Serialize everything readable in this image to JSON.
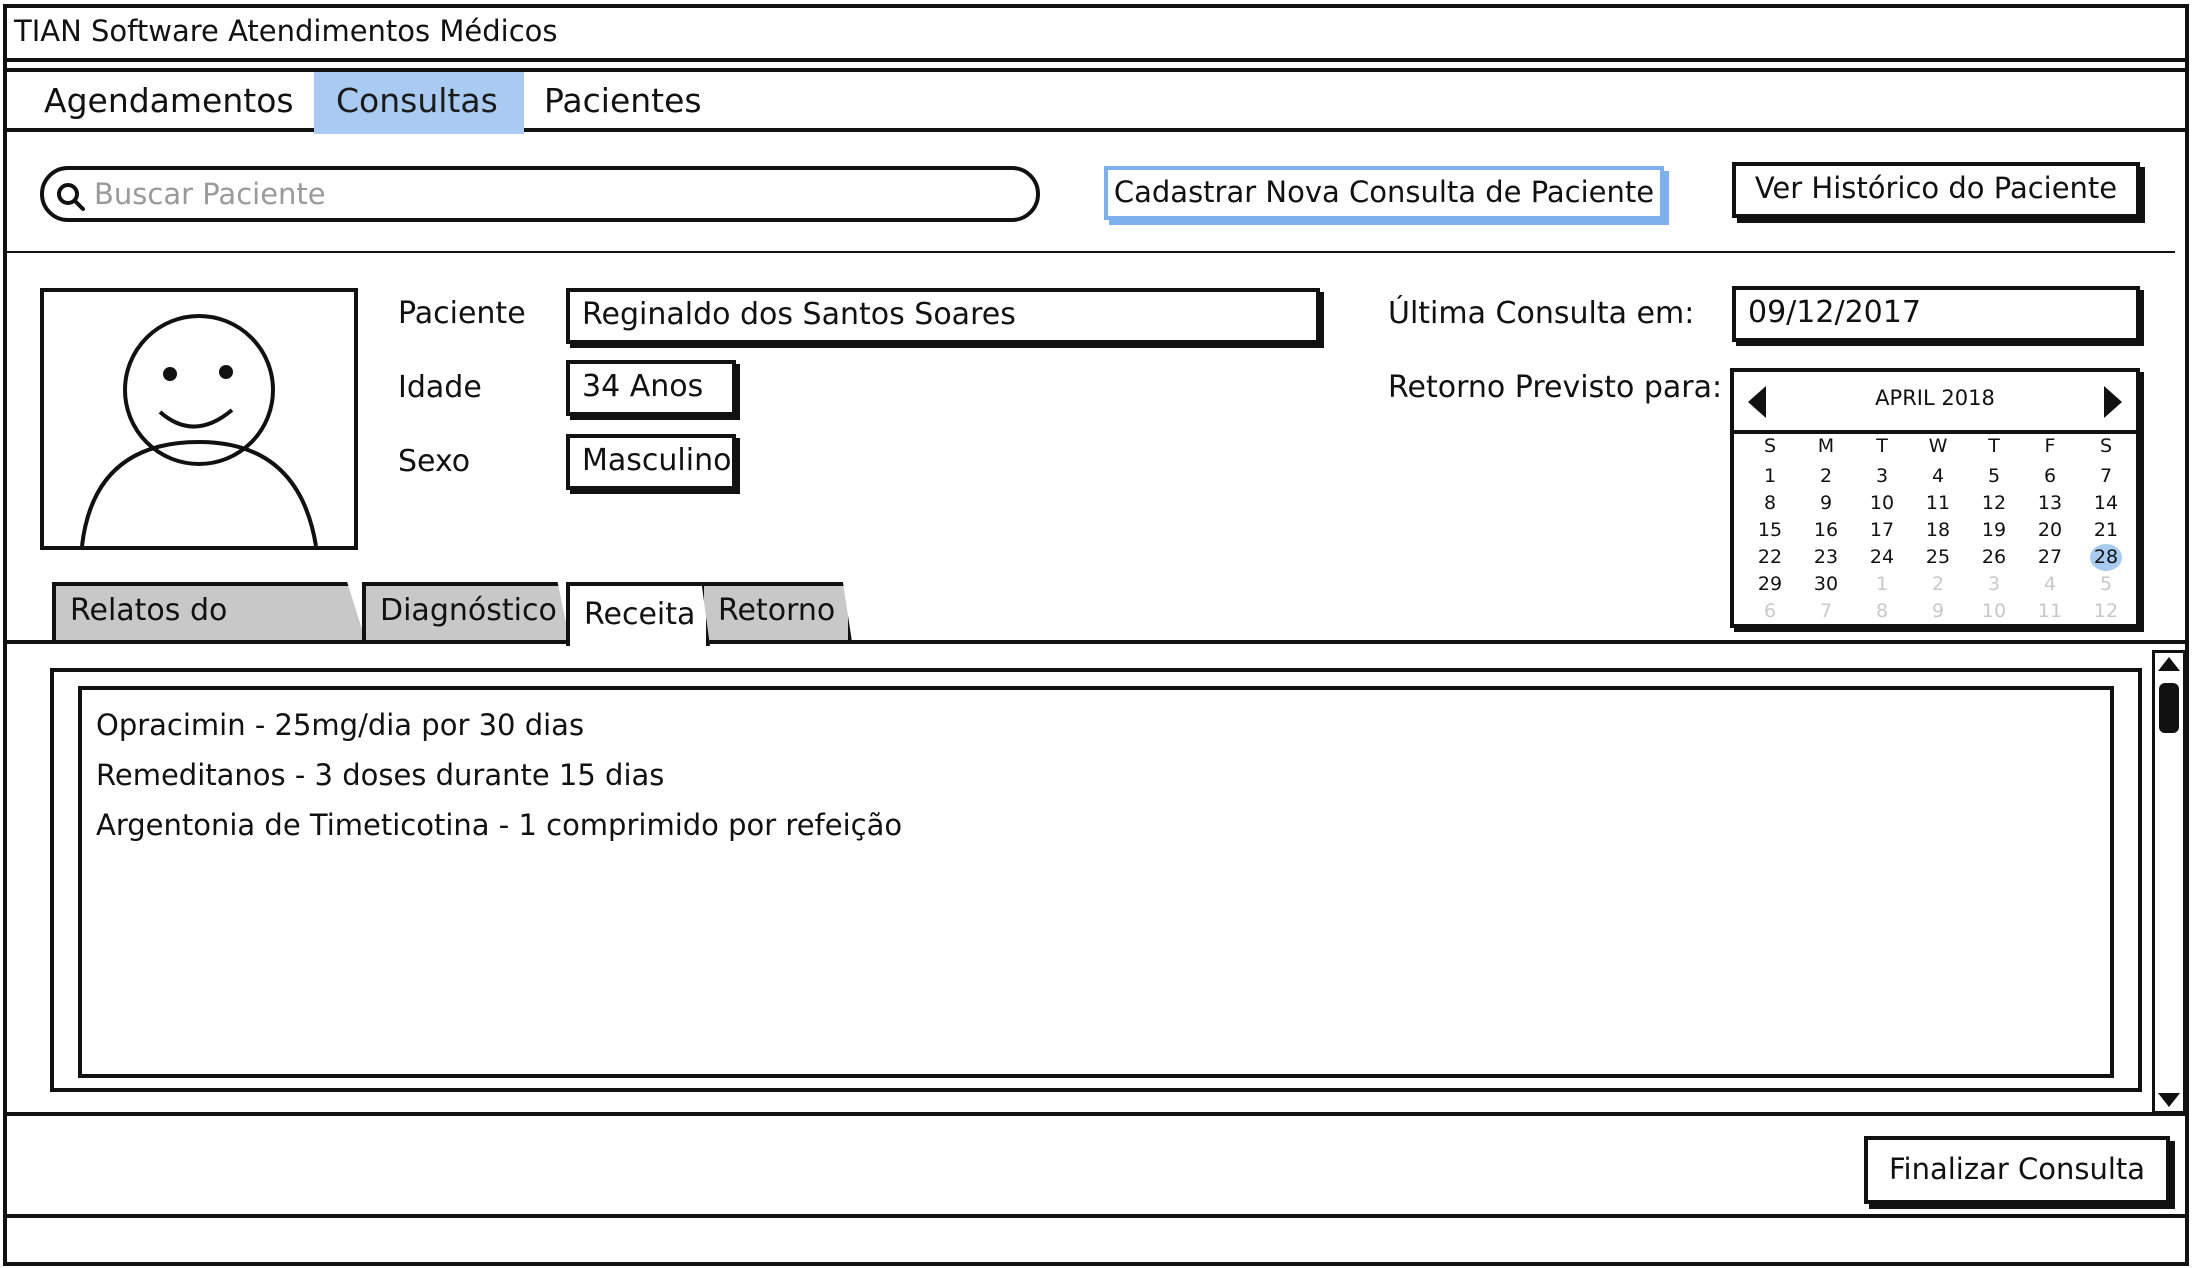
{
  "window": {
    "title": "TIAN Software Atendimentos Médicos"
  },
  "menu": {
    "items": [
      {
        "label": "Agendamentos",
        "active": false
      },
      {
        "label": "Consultas",
        "active": true
      },
      {
        "label": "Pacientes",
        "active": false
      }
    ]
  },
  "search": {
    "placeholder": "Buscar Paciente",
    "value": ""
  },
  "toolbar": {
    "new_consult_label": "Cadastrar Nova Consulta de Paciente",
    "history_label": "Ver Histórico do Paciente"
  },
  "patient": {
    "name_label": "Paciente",
    "name_value": "Reginaldo dos Santos Soares",
    "age_label": "Idade",
    "age_value": "34 Anos",
    "sex_label": "Sexo",
    "sex_value": "Masculino",
    "last_visit_label": "Última Consulta em:",
    "last_visit_value": "09/12/2017",
    "return_label": "Retorno Previsto para:"
  },
  "calendar": {
    "month_label": "APRIL 2018",
    "weekdays": [
      "S",
      "M",
      "T",
      "W",
      "T",
      "F",
      "S"
    ],
    "weeks": [
      [
        "1",
        "2",
        "3",
        "4",
        "5",
        "6",
        "7"
      ],
      [
        "8",
        "9",
        "10",
        "11",
        "12",
        "13",
        "14"
      ],
      [
        "15",
        "16",
        "17",
        "18",
        "19",
        "20",
        "21"
      ],
      [
        "22",
        "23",
        "24",
        "25",
        "26",
        "27",
        "28"
      ],
      [
        "29",
        "30",
        "1",
        "2",
        "3",
        "4",
        "5"
      ],
      [
        "6",
        "7",
        "8",
        "9",
        "10",
        "11",
        "12"
      ]
    ],
    "selected_day": "28"
  },
  "tabs": [
    {
      "label": "Relatos do Paciente",
      "active": false
    },
    {
      "label": "Diagnóstico",
      "active": false
    },
    {
      "label": "Receita",
      "active": true
    },
    {
      "label": "Retorno",
      "active": false
    }
  ],
  "prescription": {
    "lines": [
      "Opracimin - 25mg/dia por 30 dias",
      "Remeditanos - 3 doses durante 15 dias",
      "Argentonia de Timeticotina - 1 comprimido por refeição"
    ]
  },
  "footer": {
    "finish_label": "Finalizar Consulta"
  },
  "colors": {
    "accent": "#a9cbf1",
    "selected_button_border": "#7fb0ee",
    "tab_inactive": "#c8c8c8"
  }
}
